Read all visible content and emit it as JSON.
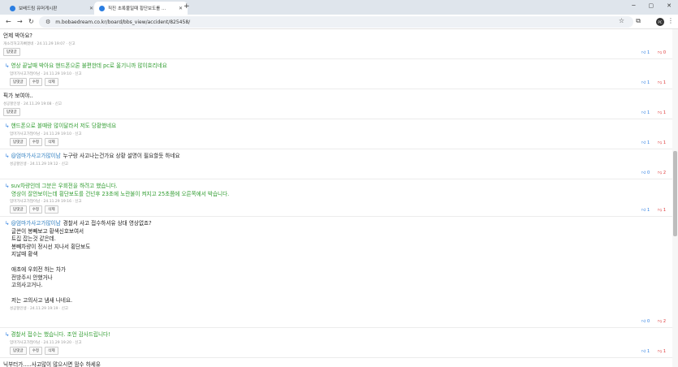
{
  "browser": {
    "tabs": [
      {
        "title": "보배드림 유머게시판",
        "active": false
      },
      {
        "title": "직진 초록불일때 횡단보도를 ...",
        "active": true
      }
    ],
    "url": "m.bobaedream.co.kr/board/bbs_view/accident/825458/",
    "profile": "PC"
  },
  "labels": {
    "reply": "답댓글",
    "edit": "수정",
    "delete": "삭제"
  },
  "comments": [
    {
      "reply": false,
      "lines": [
        "언제 박아요?"
      ],
      "meta": "개소리허고자빠졌네 · 24.11.29 19:07 · 신고",
      "buttons": [
        "reply"
      ],
      "up": "1",
      "down": "0"
    },
    {
      "reply": true,
      "green": true,
      "lines": [
        "영상 끝날때 박아요 핸드폰으론 불편한데 pc로 옮기니까 많이흐리네요"
      ],
      "meta": "엄마가사고가많이남 · 24.11.29 19:10 · 신고",
      "buttons": [
        "reply",
        "edit",
        "delete"
      ],
      "up": "1",
      "down": "1"
    },
    {
      "reply": false,
      "lines": [
        "픽가 보여야.."
      ],
      "meta": "성공할인생 · 24.11.29 19:08 · 신고",
      "buttons": [
        "reply"
      ],
      "up": "1",
      "down": "1"
    },
    {
      "reply": true,
      "green": true,
      "lines": [
        "핸드폰으로 볼때랑 많이달라서 저도 당황했네요"
      ],
      "meta": "엄마가사고가많이남 · 24.11.29 19:10 · 신고",
      "buttons": [
        "reply",
        "edit",
        "delete"
      ],
      "up": "1",
      "down": "1"
    },
    {
      "reply": true,
      "mention": "@엄마가사고가많이남",
      "lines": [
        "누구랑 사고나는건가요 상황 설명이 필요할듯 하네요"
      ],
      "meta": "성공할인생 · 24.11.29 19:12 · 신고",
      "buttons": [],
      "up": "0",
      "down": "2"
    },
    {
      "reply": true,
      "green": true,
      "lines": [
        "suv차량인데 그분은 우회전을 하려고 했습니다.",
        "영상이 잘안보이는데 횡단보도를 건넌후 23초에 노란불이 켜지고 25초쯤에 오른쪽에서 박습니다."
      ],
      "meta": "엄마가사고가많이남 · 24.11.29 19:16 · 신고",
      "buttons": [
        "reply",
        "edit",
        "delete"
      ],
      "up": "1",
      "down": "1"
    },
    {
      "reply": true,
      "mention": "@엄마가사고가많이남",
      "lines": [
        "경찰서 사고 접수하셔유 상대 영상없죠?",
        "글쓴이 봉빼보고 황색신호보여서",
        "트집 잡는것 같은데.",
        "봉빼차량이 정시선 지나서 횡단보도",
        "지날때 황색",
        "",
        "애초에 우회전 하는 차가",
        "전방주시 안했거나",
        "고의사고거나.",
        "",
        "저는 고의사고 냄새 나네요."
      ],
      "meta": "성공할인생 · 24.11.29 19:19 · 신고",
      "buttons": [],
      "up": "0",
      "down": "2"
    },
    {
      "reply": true,
      "green": true,
      "lines": [
        "경찰서 접수는 했습니다. 조언 감사드립니다!"
      ],
      "meta": "엄마가사고가많이남 · 24.11.29 19:20 · 신고",
      "buttons": [
        "reply",
        "edit",
        "delete"
      ],
      "up": "1",
      "down": "1"
    },
    {
      "reply": false,
      "lines": [
        "닉부터가.....사고많이 많으시면 맘수 하세유"
      ],
      "meta": "",
      "buttons": [],
      "up": "",
      "down": ""
    }
  ]
}
